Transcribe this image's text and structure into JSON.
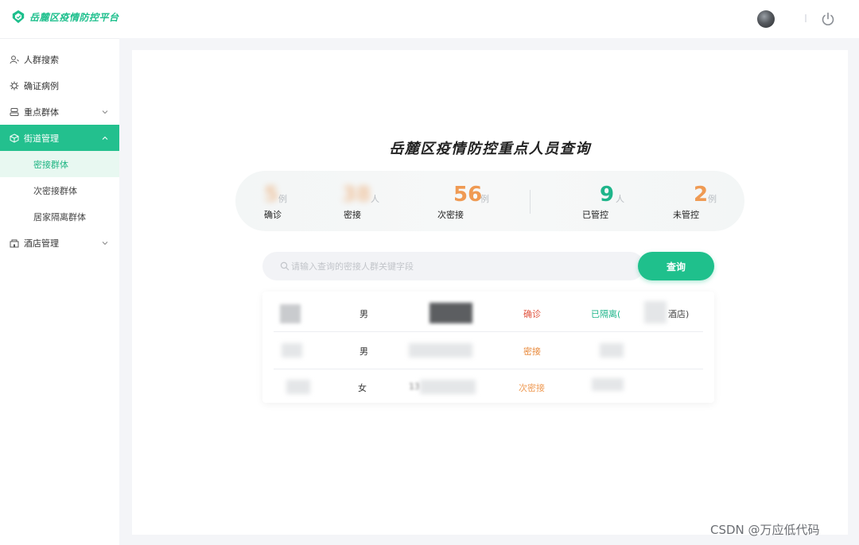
{
  "app": {
    "logo_text": "岳麓区疫情防控平台"
  },
  "sidebar": {
    "items": [
      {
        "label": "人群搜索",
        "icon": "person-search-icon"
      },
      {
        "label": "确证病例",
        "icon": "virus-icon"
      },
      {
        "label": "重点群体",
        "icon": "group-icon"
      },
      {
        "label": "街道管理",
        "icon": "cube-icon",
        "active": true,
        "expanded": true
      },
      {
        "label": "酒店管理",
        "icon": "hotel-icon"
      }
    ],
    "submenu": [
      {
        "label": "密接群体",
        "selected": true
      },
      {
        "label": "次密接群体"
      },
      {
        "label": "居家隔离群体"
      }
    ]
  },
  "main": {
    "title": "岳麓区疫情防控重点人员查询",
    "stats": [
      {
        "label": "确诊",
        "unit": "例",
        "color": "#e8893b"
      },
      {
        "label": "密接",
        "unit": "人",
        "color": "#e8893b"
      },
      {
        "label": "次密接",
        "value": "56",
        "unit": "例",
        "color": "#ef9a53"
      },
      {
        "label": "已管控",
        "value": "9",
        "unit": "人",
        "color": "#1eb58a"
      },
      {
        "label": "未管控",
        "value": "2",
        "unit": "例",
        "color": "#ef9a53"
      }
    ],
    "search": {
      "placeholder": "请输入查询的密接人群关键字段",
      "button_label": "查询"
    },
    "results": [
      {
        "gender": "男",
        "status": "确诊",
        "isolation": "已隔离(",
        "hotel_suffix": "酒店)"
      },
      {
        "gender": "男",
        "status": "密接"
      },
      {
        "gender": "女",
        "phone_prefix": "13",
        "status": "次密接"
      }
    ]
  },
  "colors": {
    "accent": "#23c08e",
    "confirmed": "#e0543f",
    "close_contact": "#e8893b",
    "isolated": "#1eb58a"
  },
  "watermark": "CSDN @万应低代码"
}
